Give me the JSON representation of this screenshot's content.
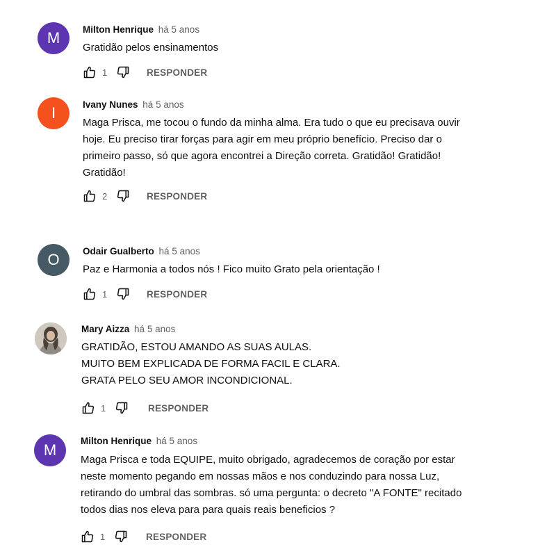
{
  "reply_label": "RESPONDER",
  "colors": {
    "avatar_purple": "#5e35b1",
    "avatar_orange": "#f4511e",
    "avatar_slate": "#455a64"
  },
  "comments": [
    {
      "initial": "M",
      "author": "Milton Henrique",
      "time": "há 5 anos",
      "text": "Gratidão pelos ensinamentos",
      "likes": "1"
    },
    {
      "initial": "I",
      "author": "Ivany Nunes",
      "time": "há 5 anos",
      "text": "Maga Prisca, me tocou o fundo da minha alma. Era tudo o que eu precisava ouvir\nhoje. Eu preciso tirar forças para agir em meu próprio benefício. Preciso dar o\nprimeiro passo, só que agora encontrei a Direção correta. Gratidão!  Gratidão!\nGratidão!",
      "likes": "2"
    },
    {
      "initial": "O",
      "author": "Odair Gualberto",
      "time": "há 5 anos",
      "text": "Paz e Harmonia a todos nós ! Fico muito Grato pela orientação !",
      "likes": "1"
    },
    {
      "initial": "",
      "author": "Mary Aizza",
      "time": "há 5 anos",
      "text": "GRATIDÃO, ESTOU AMANDO AS SUAS AULAS.\nMUITO BEM EXPLICADA DE FORMA FACIL E CLARA.\nGRATA PELO SEU AMOR INCONDICIONAL.",
      "likes": "1"
    },
    {
      "initial": "M",
      "author": "Milton Henrique",
      "time": "há 5 anos",
      "text": "Maga Prisca e toda EQUIPE, muito obrigado, agradecemos de coração por estar\nneste momento pegando em nossas mãos e nos conduzindo para nossa Luz,\nretirando do umbral das sombras. só uma pergunta: o decreto \"A FONTE\" recitado\ntodos dias nos eleva para para quais reais beneficios ?",
      "likes": "1"
    }
  ]
}
